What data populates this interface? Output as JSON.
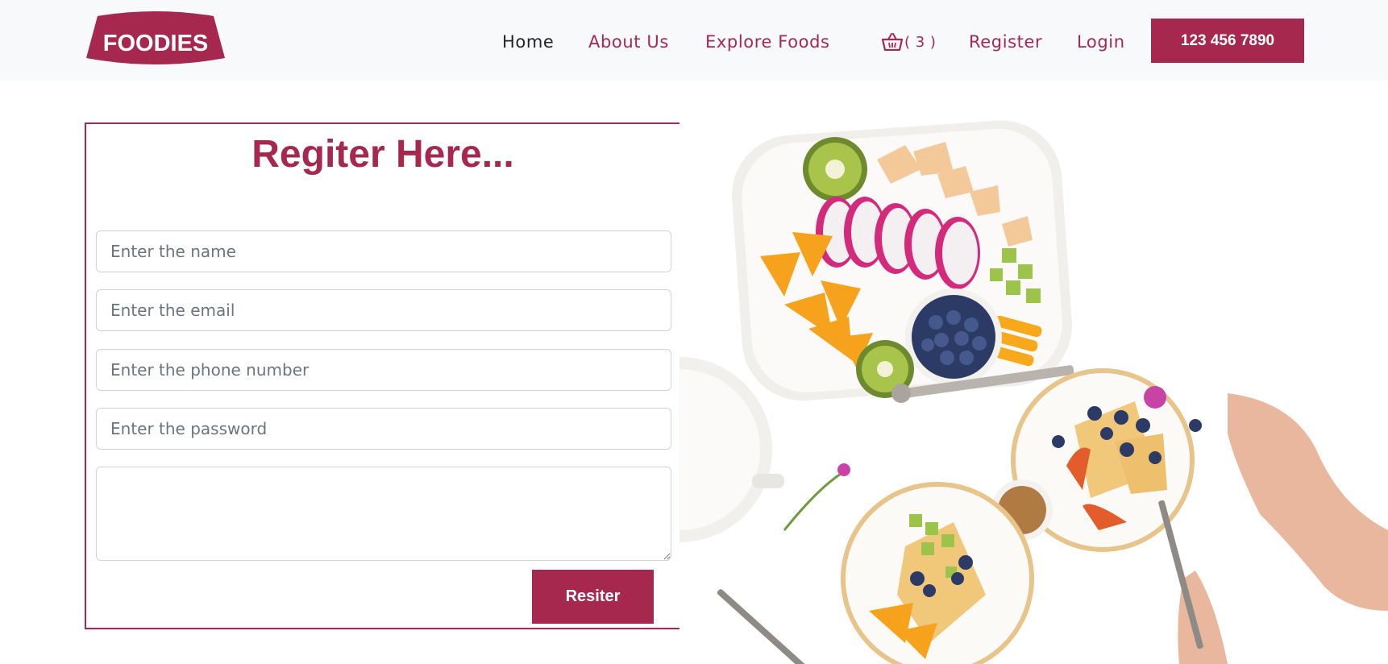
{
  "brand": {
    "name": "FOODIES",
    "color": "#a7284f"
  },
  "nav": {
    "home": "Home",
    "about": "About Us",
    "explore": "Explore Foods",
    "cart_count": "( 3 )",
    "register": "Register",
    "login": "Login",
    "phone": "123 456 7890"
  },
  "form": {
    "title": "Regiter Here...",
    "name_placeholder": "Enter the name",
    "email_placeholder": "Enter the email",
    "phone_placeholder": "Enter the phone number",
    "password_placeholder": "Enter the password",
    "message_value": "",
    "submit_label": "Resiter"
  },
  "icons": {
    "cart": "basket-icon",
    "food": "food-platter-image"
  }
}
